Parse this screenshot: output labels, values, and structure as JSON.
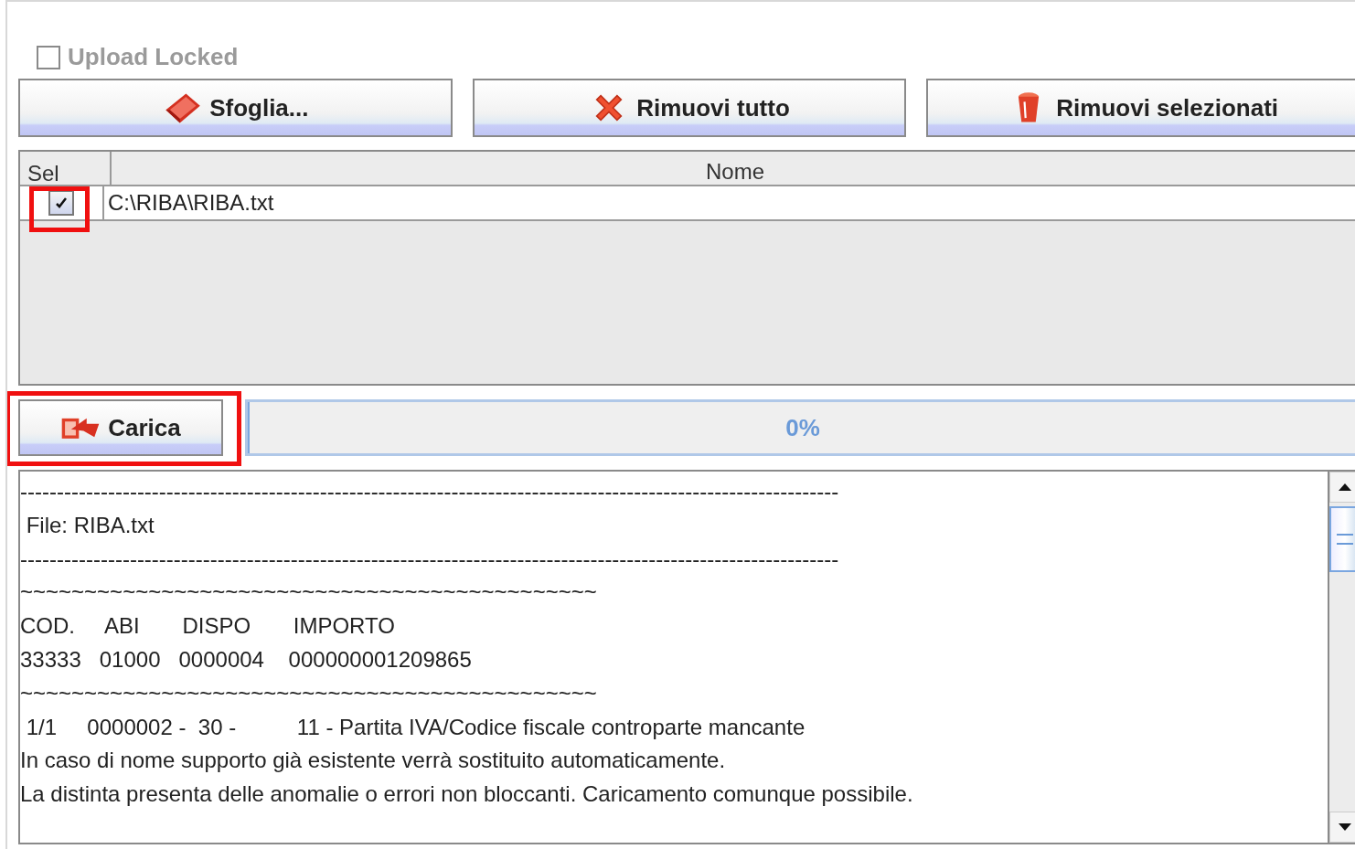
{
  "upload_locked": {
    "label": "Upload Locked",
    "checked": false,
    "disabled": true
  },
  "buttons": [
    {
      "kind": "browse",
      "label": "Sfoglia..."
    },
    {
      "kind": "remove-all",
      "label": "Rimuovi tutto"
    },
    {
      "kind": "remove-selected",
      "label": "Rimuovi selezionati"
    }
  ],
  "table": {
    "columns": [
      "Sel",
      "Nome"
    ],
    "rows": [
      {
        "checked": true,
        "highlighted": true,
        "name": "C:\\RIBA\\RIBA.txt"
      }
    ]
  },
  "upload": {
    "label": "Carica",
    "highlighted": true
  },
  "progress": {
    "level": 0,
    "reading": "0%"
  },
  "log": {
    "lines": [
      "----------------------------------------------------------------------------------------------------------------",
      " File: RIBA.txt",
      "----------------------------------------------------------------------------------------------------------------",
      "~~~~~~~~~~~~~~~~~~~~~~~~~~~~~~~~~~~~~~~~~~~~~",
      "COD.     ABI       DISPO       IMPORTO",
      "33333   01000   0000004    000000001209865",
      "~~~~~~~~~~~~~~~~~~~~~~~~~~~~~~~~~~~~~~~~~~~~~",
      " 1/1     0000002 -  30 -          11 - Partita IVA/Codice fiscale controparte mancante",
      "In caso di nome supporto già esistente verrà sostituito automaticamente.",
      "La distinta presenta delle anomalie o errori non bloccanti. Caricamento comunque possibile."
    ]
  }
}
